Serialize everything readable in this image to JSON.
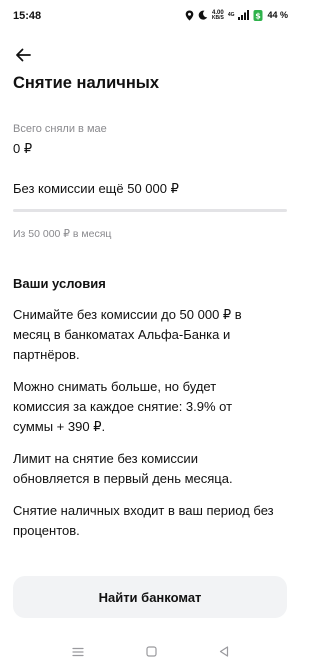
{
  "status_bar": {
    "time": "15:48",
    "net_speed_value": "4.00",
    "net_speed_unit": "KB/S",
    "network_type": "4G",
    "battery_percent": "44 %"
  },
  "header": {
    "title": "Снятие наличных"
  },
  "summary": {
    "spent_label": "Всего сняли в мае",
    "spent_value": "0 ₽",
    "free_left_text": "Без комиссии ещё 50 000 ₽",
    "progress_fraction": 0,
    "limit_note": "Из 50 000 ₽ в месяц"
  },
  "conditions": {
    "title": "Ваши условия",
    "paragraphs": [
      "Снимайте без комиссии до 50 000 ₽ в месяц в банкоматах Альфа-Банка и партнёров.",
      "Можно снимать больше, но будет комиссия за каждое снятие: 3.9% от суммы + 390 ₽.",
      "Лимит на снятие без комиссии обновляется в первый день месяца.",
      "Снятие наличных входит в ваш период без процентов."
    ]
  },
  "actions": {
    "find_atm_label": "Найти банкомат"
  },
  "nav_icons": [
    "menu-icon",
    "home-square-icon",
    "back-triangle-icon"
  ],
  "colors": {
    "progress_track": "#e3e3e6",
    "button_bg": "#f2f3f5",
    "battery_badge": "#2eb24b"
  }
}
